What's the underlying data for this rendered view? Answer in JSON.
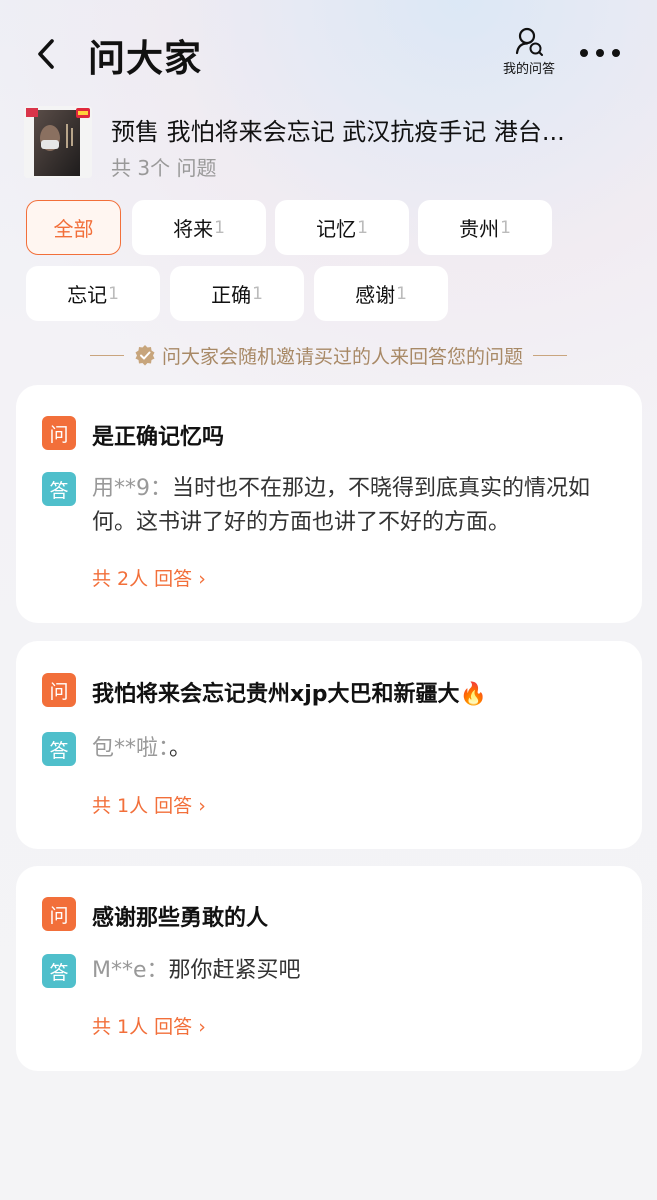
{
  "header": {
    "title": "问大家",
    "my_questions_label": "我的问答",
    "icons": {
      "back": "back-chevron-icon",
      "my_questions": "user-question-icon",
      "more": "more-dots-icon"
    }
  },
  "product": {
    "title": "预售 我怕将来会忘记 武汉抗疫手记 港台...",
    "question_count": "共 3个 问题"
  },
  "tags": [
    {
      "label": "全部",
      "count": "",
      "active": true
    },
    {
      "label": "将来",
      "count": "1"
    },
    {
      "label": "记忆",
      "count": "1"
    },
    {
      "label": "贵州",
      "count": "1"
    },
    {
      "label": "忘记",
      "count": "1"
    },
    {
      "label": "正确",
      "count": "1"
    },
    {
      "label": "感谢",
      "count": "1"
    }
  ],
  "notice": {
    "text": "问大家会随机邀请买过的人来回答您的问题",
    "icon": "verified-badge-icon"
  },
  "badges": {
    "question": "问",
    "answer": "答"
  },
  "questions": [
    {
      "question": "是正确记忆吗",
      "answer_user": "用**9：",
      "answer_text": "当时也不在那边，不晓得到底真实的情况如何。这书讲了好的方面也讲了不好的方面。",
      "answer_count": "共 2人 回答 ›"
    },
    {
      "question": "我怕将来会忘记贵州xjp大巴和新疆大🔥",
      "answer_user": "包**啦：",
      "answer_text": "。",
      "answer_count": "共 1人 回答 ›"
    },
    {
      "question": "感谢那些勇敢的人",
      "answer_user": "M**e：",
      "answer_text": "那你赶紧买吧",
      "answer_count": "共 1人 回答 ›"
    }
  ],
  "colors": {
    "accent": "#f26f3a",
    "answer_badge": "#4fbfcb",
    "notice": "#a88966"
  }
}
